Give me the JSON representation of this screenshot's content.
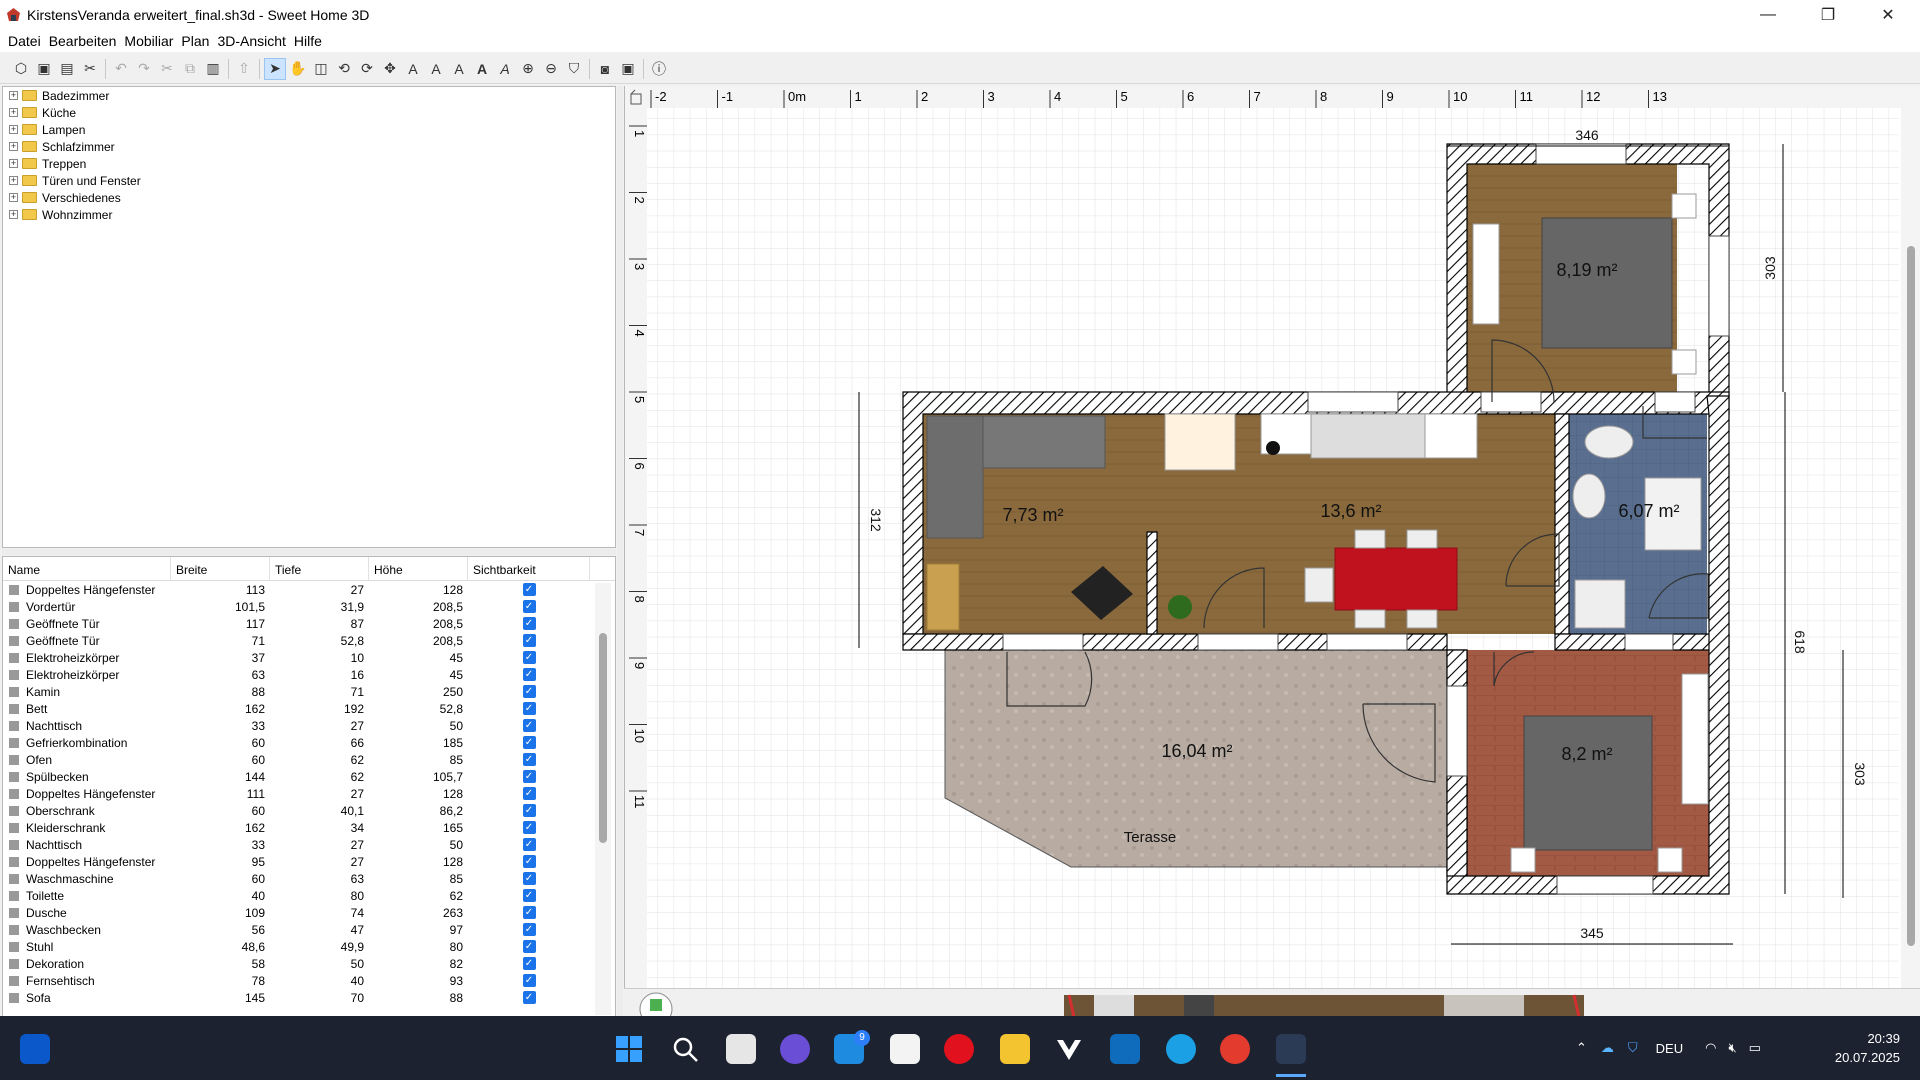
{
  "window": {
    "title": "KirstensVeranda erweitert_final.sh3d - Sweet Home 3D",
    "minimize_glyph": "—",
    "maximize_glyph": "❐",
    "close_glyph": "✕"
  },
  "menu": [
    "Datei",
    "Bearbeiten",
    "Mobiliar",
    "Plan",
    "3D-Ansicht",
    "Hilfe"
  ],
  "catalog": {
    "categories": [
      "Badezimmer",
      "Küche",
      "Lampen",
      "Schlafzimmer",
      "Treppen",
      "Türen und Fenster",
      "Verschiedenes",
      "Wohnzimmer"
    ]
  },
  "furniture_table": {
    "headers": [
      "Name",
      "Breite",
      "Tiefe",
      "Höhe",
      "Sichtbarkeit"
    ],
    "rows": [
      {
        "name": "Doppeltes Hängefenster",
        "width": "113",
        "depth": "27",
        "height": "128"
      },
      {
        "name": "Vordertür",
        "width": "101,5",
        "depth": "31,9",
        "height": "208,5"
      },
      {
        "name": "Geöffnete Tür",
        "width": "117",
        "depth": "87",
        "height": "208,5"
      },
      {
        "name": "Geöffnete Tür",
        "width": "71",
        "depth": "52,8",
        "height": "208,5"
      },
      {
        "name": "Elektroheizkörper",
        "width": "37",
        "depth": "10",
        "height": "45"
      },
      {
        "name": "Elektroheizkörper",
        "width": "63",
        "depth": "16",
        "height": "45"
      },
      {
        "name": "Kamin",
        "width": "88",
        "depth": "71",
        "height": "250"
      },
      {
        "name": "Bett",
        "width": "162",
        "depth": "192",
        "height": "52,8"
      },
      {
        "name": "Nachttisch",
        "width": "33",
        "depth": "27",
        "height": "50"
      },
      {
        "name": "Gefrierkombination",
        "width": "60",
        "depth": "66",
        "height": "185"
      },
      {
        "name": "Ofen",
        "width": "60",
        "depth": "62",
        "height": "85"
      },
      {
        "name": "Spülbecken",
        "width": "144",
        "depth": "62",
        "height": "105,7"
      },
      {
        "name": "Doppeltes Hängefenster",
        "width": "111",
        "depth": "27",
        "height": "128"
      },
      {
        "name": "Oberschrank",
        "width": "60",
        "depth": "40,1",
        "height": "86,2"
      },
      {
        "name": "Kleiderschrank",
        "width": "162",
        "depth": "34",
        "height": "165"
      },
      {
        "name": "Nachttisch",
        "width": "33",
        "depth": "27",
        "height": "50"
      },
      {
        "name": "Doppeltes Hängefenster",
        "width": "95",
        "depth": "27",
        "height": "128"
      },
      {
        "name": "Waschmaschine",
        "width": "60",
        "depth": "63",
        "height": "85"
      },
      {
        "name": "Toilette",
        "width": "40",
        "depth": "80",
        "height": "62"
      },
      {
        "name": "Dusche",
        "width": "109",
        "depth": "74",
        "height": "263"
      },
      {
        "name": "Waschbecken",
        "width": "56",
        "depth": "47",
        "height": "97"
      },
      {
        "name": "Stuhl",
        "width": "48,6",
        "depth": "49,9",
        "height": "80"
      },
      {
        "name": "Dekoration",
        "width": "58",
        "depth": "50",
        "height": "82"
      },
      {
        "name": "Fernsehtisch",
        "width": "78",
        "depth": "40",
        "height": "93"
      },
      {
        "name": "Sofa",
        "width": "145",
        "depth": "70",
        "height": "88"
      }
    ]
  },
  "plan": {
    "ruler_x": [
      "-2",
      "-1",
      "0m",
      "1",
      "2",
      "3",
      "4",
      "5",
      "6",
      "7",
      "8",
      "9",
      "10",
      "11",
      "12",
      "13"
    ],
    "ruler_y": [
      "1",
      "2",
      "3",
      "4",
      "5",
      "6",
      "7",
      "8",
      "9",
      "10",
      "11"
    ],
    "rooms": [
      {
        "area": "8,19 m²"
      },
      {
        "area": "7,73 m²"
      },
      {
        "area": "13,6 m²"
      },
      {
        "area": "6,07 m²"
      },
      {
        "area": "16,04 m²",
        "name": "Terasse"
      },
      {
        "area": "8,2 m²"
      }
    ],
    "dimensions": [
      "346",
      "303",
      "312",
      "618",
      "303",
      "345"
    ]
  },
  "taskbar": {
    "language": "DEU",
    "time": "20:39",
    "date": "20.07.2025",
    "badge_count": "9"
  },
  "colors": {
    "floor_wood": "#8a6a3d",
    "floor_tile_blue": "#5a6f8f",
    "floor_brick": "#a35a44",
    "terrace": "#b8aba2",
    "grid": "#d9d9d9",
    "selection_blue": "#1a73e8"
  }
}
